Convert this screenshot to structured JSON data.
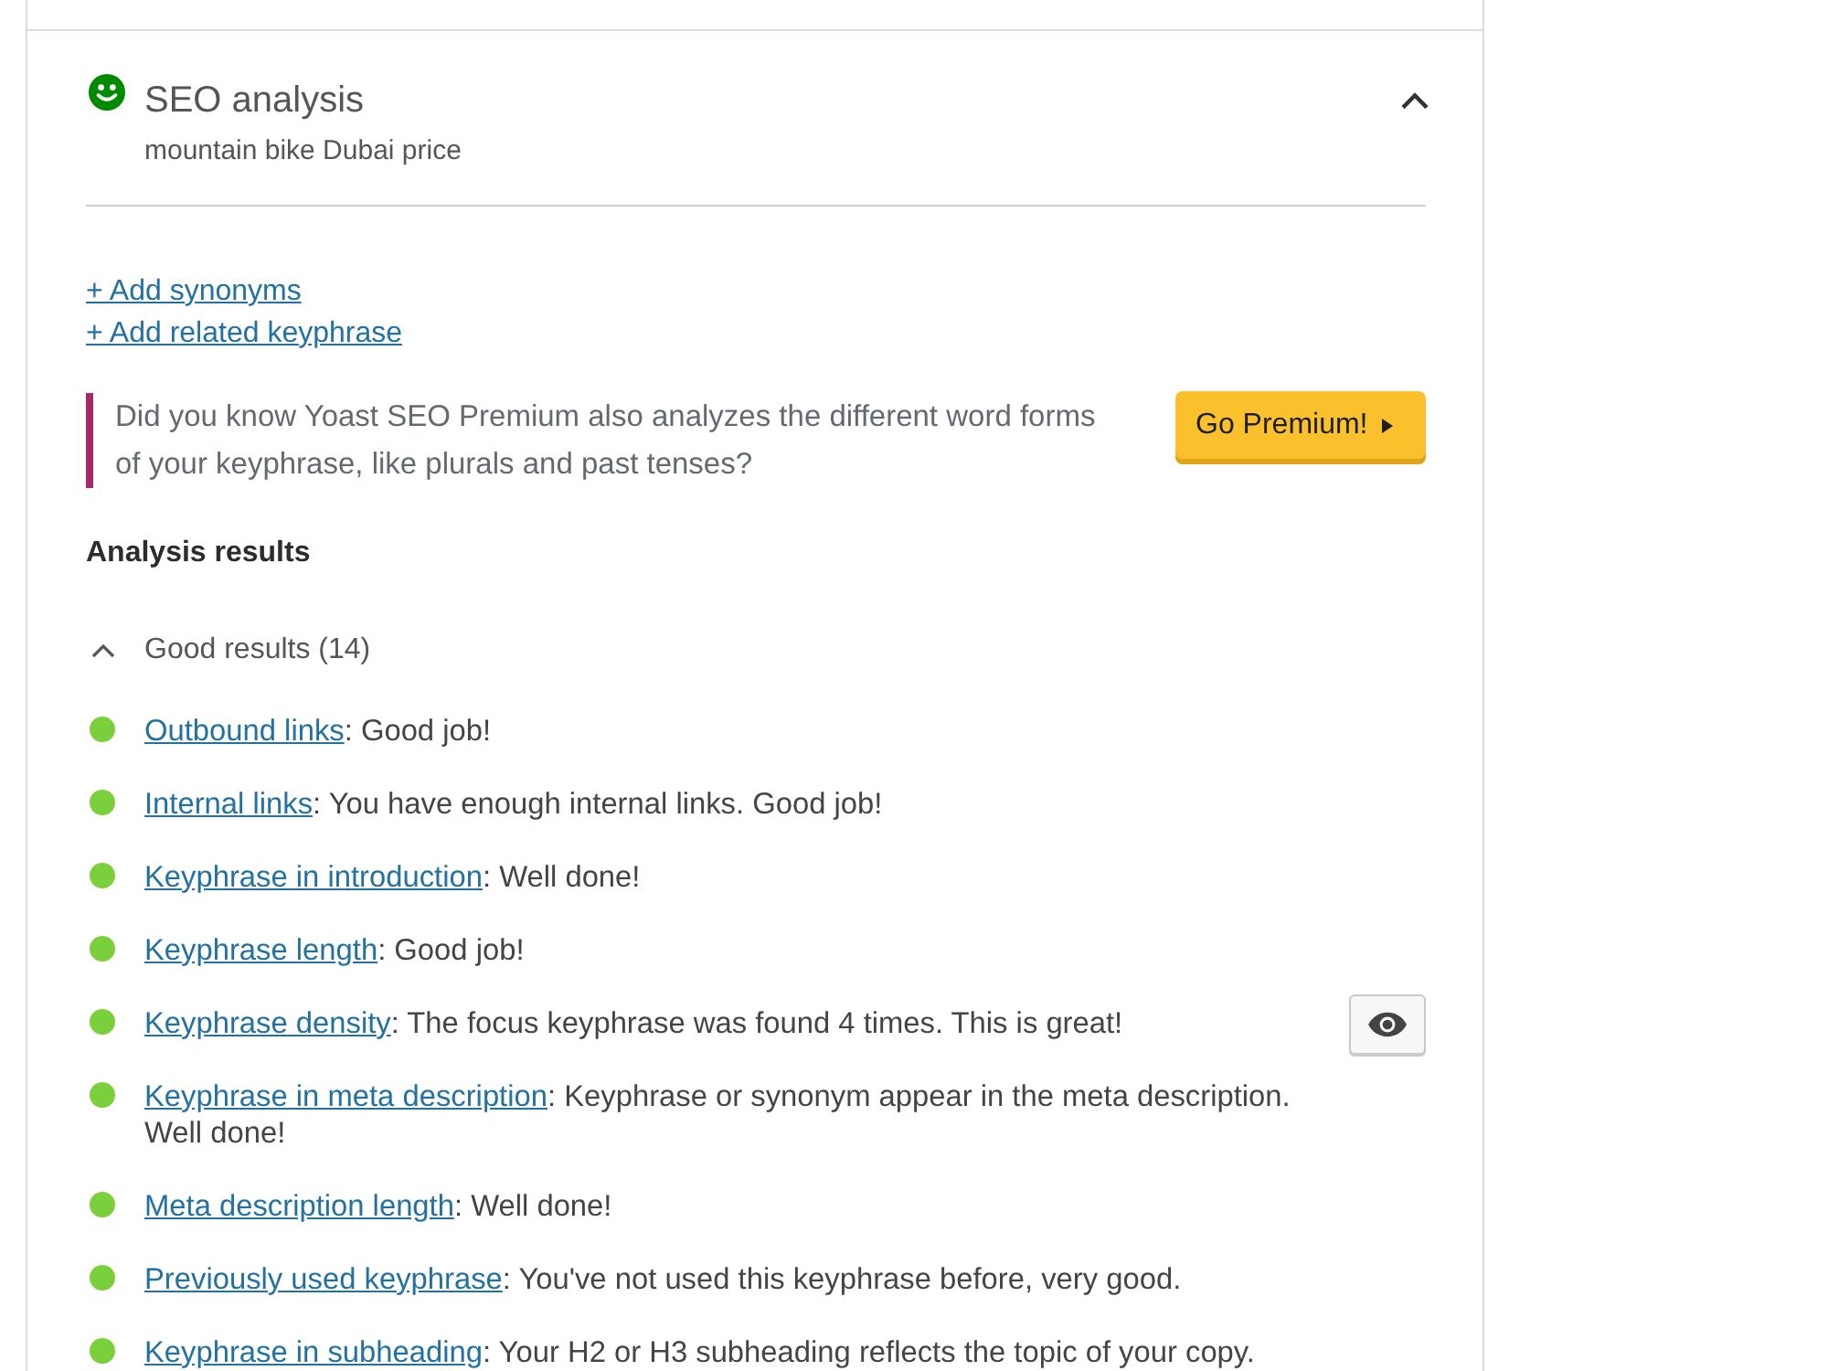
{
  "section": {
    "title": "SEO analysis",
    "subtitle": "mountain bike Dubai price",
    "color": "#008a00",
    "expanded": true
  },
  "actions": [
    {
      "label": "+ Add synonyms"
    },
    {
      "label": "+ Add related keyphrase"
    }
  ],
  "upsell": {
    "text": "Did you know Yoast SEO Premium also analyzes the different word forms of your keyphrase, like plurals and past tenses?",
    "button": "Go Premium!"
  },
  "analysis": {
    "heading": "Analysis results",
    "groups": [
      {
        "label": "Good results (14)",
        "expanded": true,
        "items": [
          {
            "link": "Outbound links",
            "text": ": Good job!",
            "color": "#7ad03a",
            "marker_button": false
          },
          {
            "link": "Internal links",
            "text": ": You have enough internal links. Good job!",
            "color": "#7ad03a",
            "marker_button": false
          },
          {
            "link": "Keyphrase in introduction",
            "text": ": Well done!",
            "color": "#7ad03a",
            "marker_button": false
          },
          {
            "link": "Keyphrase length",
            "text": ": Good job!",
            "color": "#7ad03a",
            "marker_button": false
          },
          {
            "link": "Keyphrase density",
            "text": ": The focus keyphrase was found 4 times. This is great!",
            "color": "#7ad03a",
            "marker_button": true
          },
          {
            "link": "Keyphrase in meta description",
            "text": ": Keyphrase or synonym appear in the meta description. Well done!",
            "color": "#7ad03a",
            "marker_button": false
          },
          {
            "link": "Meta description length",
            "text": ": Well done!",
            "color": "#7ad03a",
            "marker_button": false
          },
          {
            "link": "Previously used keyphrase",
            "text": ": You've not used this keyphrase before, very good.",
            "color": "#7ad03a",
            "marker_button": false
          },
          {
            "link": "Keyphrase in subheading",
            "text": ": Your H2 or H3 subheading reflects the topic of your copy.",
            "color": "#7ad03a",
            "marker_button": false
          }
        ]
      }
    ]
  }
}
